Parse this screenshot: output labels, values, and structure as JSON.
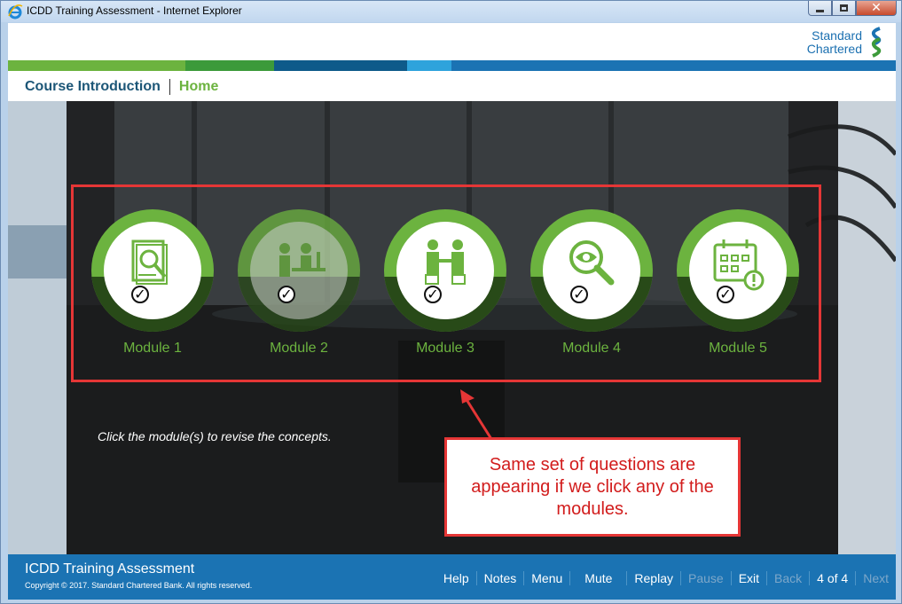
{
  "window": {
    "title": "ICDD Training Assessment - Internet Explorer"
  },
  "logo": {
    "line1": "Standard",
    "line2": "Chartered"
  },
  "colors": {
    "green": "#6cb33f",
    "dark_green": "#3c9a3a",
    "navy": "#0e5a8a",
    "blue": "#1b73b3",
    "light_blue": "#2ea3dc",
    "red": "#e53636"
  },
  "breadcrumb": {
    "course": "Course Introduction",
    "home": "Home"
  },
  "modules": [
    {
      "label": "Module 1",
      "icon": "document-magnifier-icon",
      "completed": true,
      "dimmed": false
    },
    {
      "label": "Module 2",
      "icon": "people-at-desk-icon",
      "completed": true,
      "dimmed": true
    },
    {
      "label": "Module 3",
      "icon": "handshake-icon",
      "completed": true,
      "dimmed": false
    },
    {
      "label": "Module 4",
      "icon": "eye-magnifier-icon",
      "completed": true,
      "dimmed": false
    },
    {
      "label": "Module 5",
      "icon": "calendar-alert-icon",
      "completed": true,
      "dimmed": false
    }
  ],
  "instruction": "Click the module(s) to revise the concepts.",
  "callout": "Same set of questions are appearing if we click any of the modules.",
  "footer": {
    "title": "ICDD Training Assessment",
    "copyright": "Copyright © 2017. Standard Chartered Bank. All rights reserved.",
    "help": "Help",
    "notes": "Notes",
    "menu": "Menu",
    "mute": "Mute",
    "replay": "Replay",
    "pause": "Pause",
    "exit": "Exit",
    "back": "Back",
    "page": "4 of 4",
    "next": "Next"
  }
}
